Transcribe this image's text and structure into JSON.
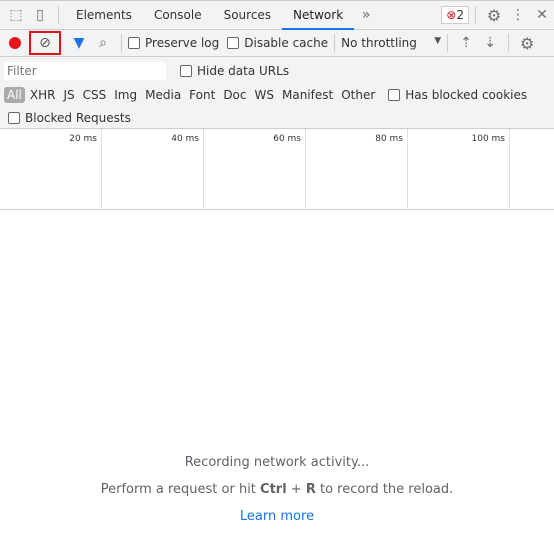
{
  "tabs": [
    "Elements",
    "Console",
    "Sources",
    "Network"
  ],
  "active_tab": "Network",
  "error_count": "2",
  "toolbar": {
    "preserve_log": "Preserve log",
    "disable_cache": "Disable cache",
    "throttling": "No throttling"
  },
  "filter": {
    "placeholder": "Filter",
    "hide_data_urls": "Hide data URLs",
    "types": [
      "All",
      "XHR",
      "JS",
      "CSS",
      "Img",
      "Media",
      "Font",
      "Doc",
      "WS",
      "Manifest",
      "Other"
    ],
    "has_blocked_cookies": "Has blocked cookies",
    "blocked_requests": "Blocked Requests"
  },
  "timeline": [
    "20 ms",
    "40 ms",
    "60 ms",
    "80 ms",
    "100 ms"
  ],
  "empty": {
    "recording": "Recording network activity...",
    "hint_pre": "Perform a request or hit ",
    "ctrl": "Ctrl",
    "plus": " + ",
    "r": "R",
    "hint_post": " to record the reload.",
    "learn_more": "Learn more"
  },
  "colors": {
    "record": "#e8141a",
    "accent": "#1a73e8",
    "highlight": "#e0131c"
  }
}
